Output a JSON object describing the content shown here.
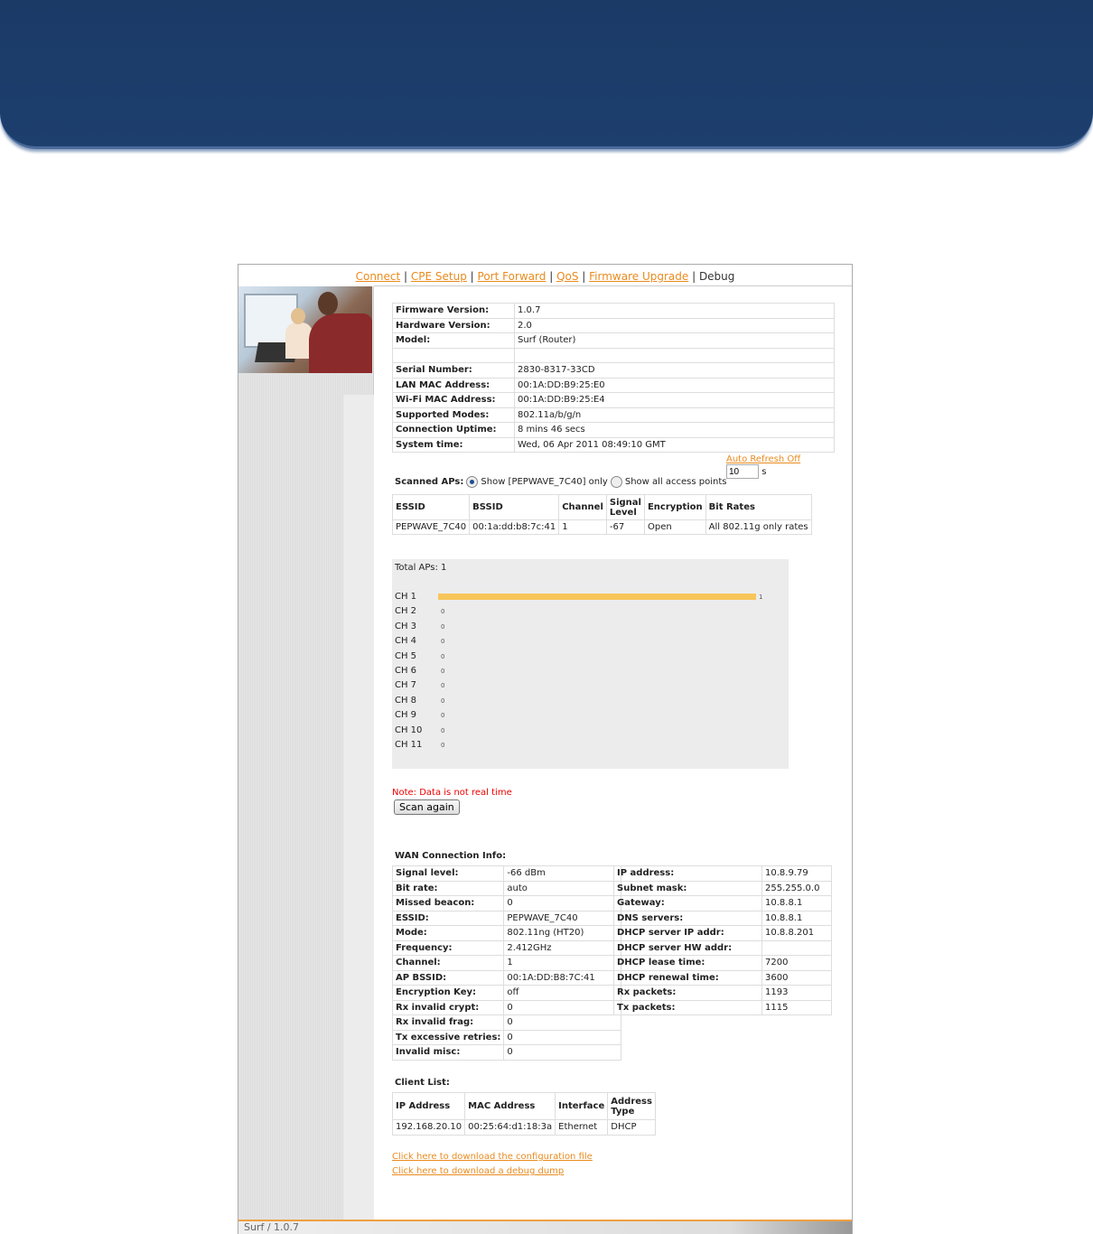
{
  "nav": {
    "links": [
      "Connect",
      "CPE Setup",
      "Port Forward",
      "QoS",
      "Firmware Upgrade"
    ],
    "current": "Debug",
    "separator": "|"
  },
  "device_info": [
    {
      "k": "Firmware Version:",
      "v": "1.0.7"
    },
    {
      "k": "Hardware Version:",
      "v": "2.0"
    },
    {
      "k": "Model:",
      "v": "Surf (Router)"
    },
    {
      "k": "",
      "v": ""
    },
    {
      "k": "Serial Number:",
      "v": "2830-8317-33CD"
    },
    {
      "k": "LAN MAC Address:",
      "v": "00:1A:DD:B9:25:E0"
    },
    {
      "k": "Wi-Fi MAC Address:",
      "v": "00:1A:DD:B9:25:E4"
    },
    {
      "k": "Supported Modes:",
      "v": "802.11a/b/g/n"
    },
    {
      "k": "Connection Uptime:",
      "v": "8 mins 46 secs"
    },
    {
      "k": "System time:",
      "v": "Wed, 06 Apr 2011 08:49:10 GMT"
    }
  ],
  "refresh": {
    "label": "Auto Refresh Off",
    "value": "10",
    "unit": "s"
  },
  "scan": {
    "label": "Scanned APs:",
    "option_show_only": "Show [PEPWAVE_7C40] only",
    "option_show_all": "Show all access points",
    "headers": [
      "ESSID",
      "BSSID",
      "Channel",
      "Signal Level",
      "Encryption",
      "Bit Rates"
    ],
    "rows": [
      [
        "PEPWAVE_7C40",
        "00:1a:dd:b8:7c:41",
        "1",
        "-67",
        "Open",
        "All 802.11g only rates"
      ]
    ]
  },
  "chart_data": {
    "type": "bar",
    "title": "Total APs: 1",
    "categories": [
      "CH 1",
      "CH 2",
      "CH 3",
      "CH 4",
      "CH 5",
      "CH 6",
      "CH 7",
      "CH 8",
      "CH 9",
      "CH 10",
      "CH 11"
    ],
    "values": [
      1,
      0,
      0,
      0,
      0,
      0,
      0,
      0,
      0,
      0,
      0
    ],
    "orientation": "horizontal",
    "bar_color": "#f7c65a"
  },
  "note": "Note: Data is not real time",
  "scan_button": "Scan again",
  "wan": {
    "title": "WAN Connection Info:",
    "left": [
      {
        "k": "Signal level:",
        "v": "-66 dBm"
      },
      {
        "k": "Bit rate:",
        "v": "auto"
      },
      {
        "k": "Missed beacon:",
        "v": "0"
      },
      {
        "k": "ESSID:",
        "v": "PEPWAVE_7C40"
      },
      {
        "k": "Mode:",
        "v": "802.11ng (HT20)"
      },
      {
        "k": "Frequency:",
        "v": "2.412GHz"
      },
      {
        "k": "Channel:",
        "v": "1"
      },
      {
        "k": "AP BSSID:",
        "v": "00:1A:DD:B8:7C:41"
      },
      {
        "k": "Encryption Key:",
        "v": "off"
      },
      {
        "k": "Rx invalid crypt:",
        "v": "0"
      },
      {
        "k": "Rx invalid frag:",
        "v": "0"
      },
      {
        "k": "Tx excessive retries:",
        "v": "0"
      },
      {
        "k": "Invalid misc:",
        "v": "0"
      }
    ],
    "right": [
      {
        "k": "IP address:",
        "v": "10.8.9.79"
      },
      {
        "k": "Subnet mask:",
        "v": "255.255.0.0"
      },
      {
        "k": "Gateway:",
        "v": "10.8.8.1"
      },
      {
        "k": "DNS servers:",
        "v": "10.8.8.1"
      },
      {
        "k": "DHCP server IP addr:",
        "v": "10.8.8.201"
      },
      {
        "k": "DHCP server HW addr:",
        "v": ""
      },
      {
        "k": "DHCP lease time:",
        "v": "7200"
      },
      {
        "k": "DHCP renewal time:",
        "v": "3600"
      },
      {
        "k": "Rx packets:",
        "v": "1193"
      },
      {
        "k": "Tx packets:",
        "v": "1115"
      }
    ]
  },
  "clients": {
    "title": "Client List:",
    "headers": [
      "IP Address",
      "MAC Address",
      "Interface",
      "Address Type"
    ],
    "rows": [
      [
        "192.168.20.10",
        "00:25:64:d1:18:3a",
        "Ethernet",
        "DHCP"
      ]
    ]
  },
  "downloads": [
    "Click here to download the configuration file",
    "Click here to download a debug dump"
  ],
  "footer": "Surf / 1.0.7"
}
